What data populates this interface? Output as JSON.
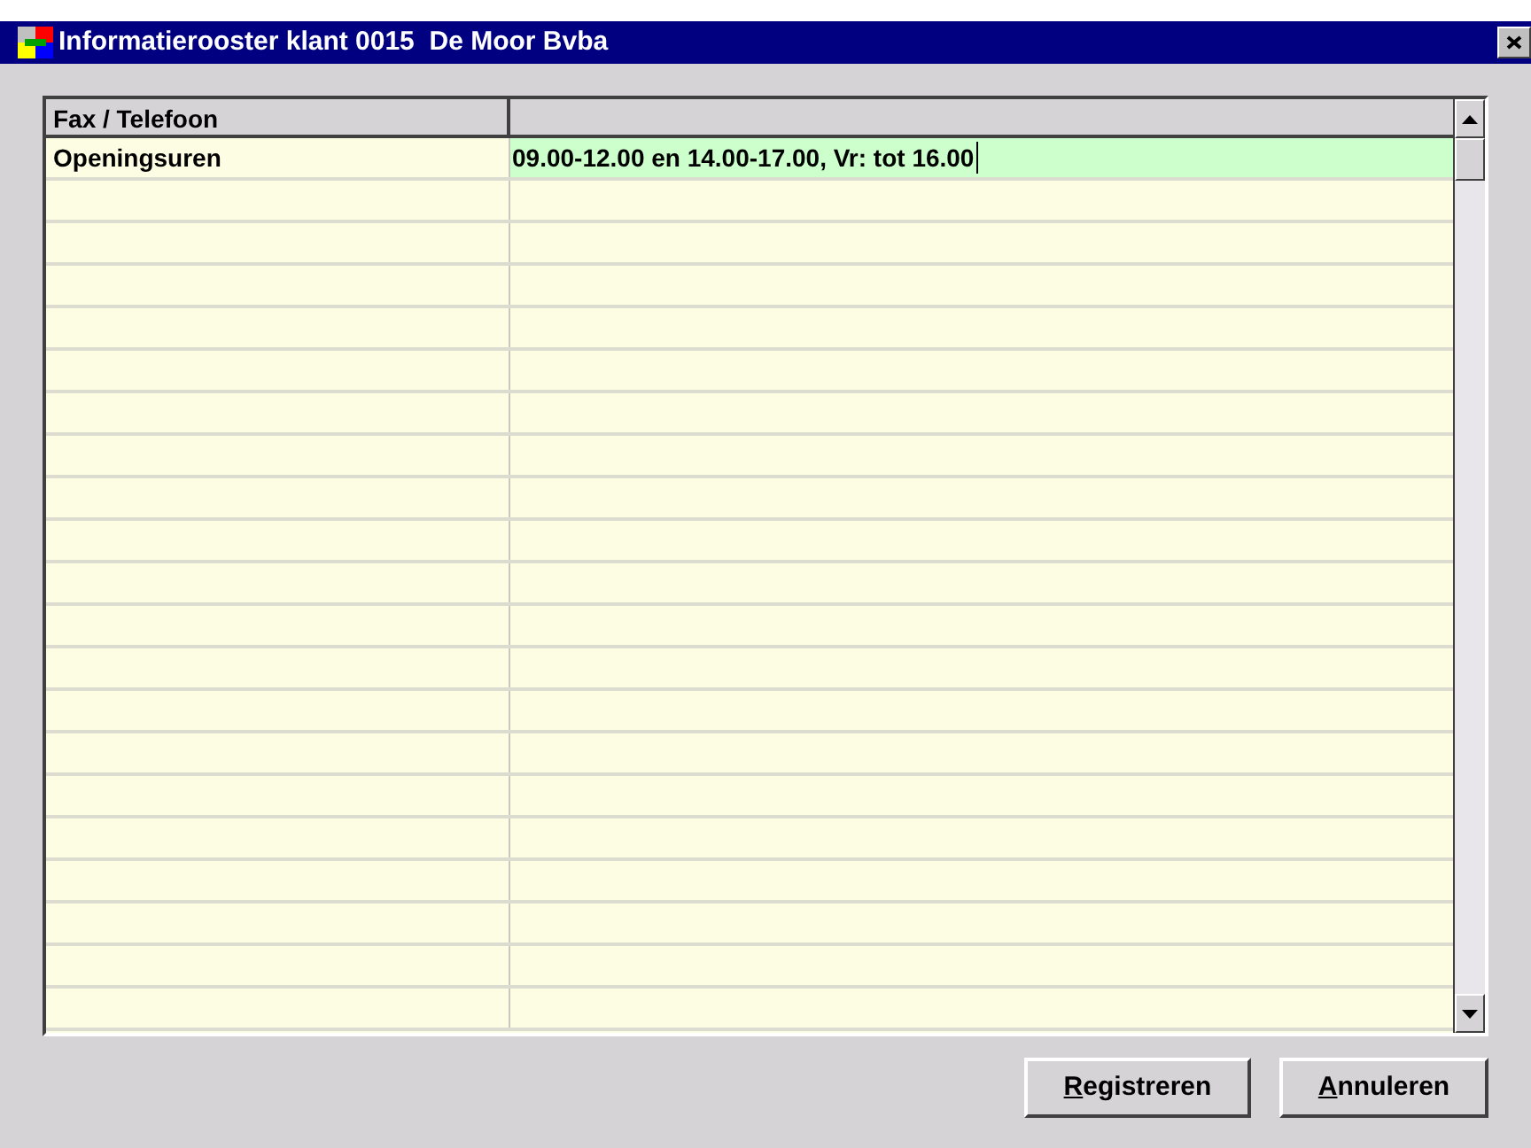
{
  "window": {
    "title": "Informatierooster klant 0015  De Moor Bvba"
  },
  "table": {
    "columns": [
      "Fax / Telefoon"
    ],
    "rows": [
      {
        "label": "Openingsuren",
        "value": "09.00-12.00 en 14.00-17.00, Vr: tot 16.00",
        "editing": true
      }
    ]
  },
  "buttons": [
    "Registreren",
    "Annuleren"
  ]
}
